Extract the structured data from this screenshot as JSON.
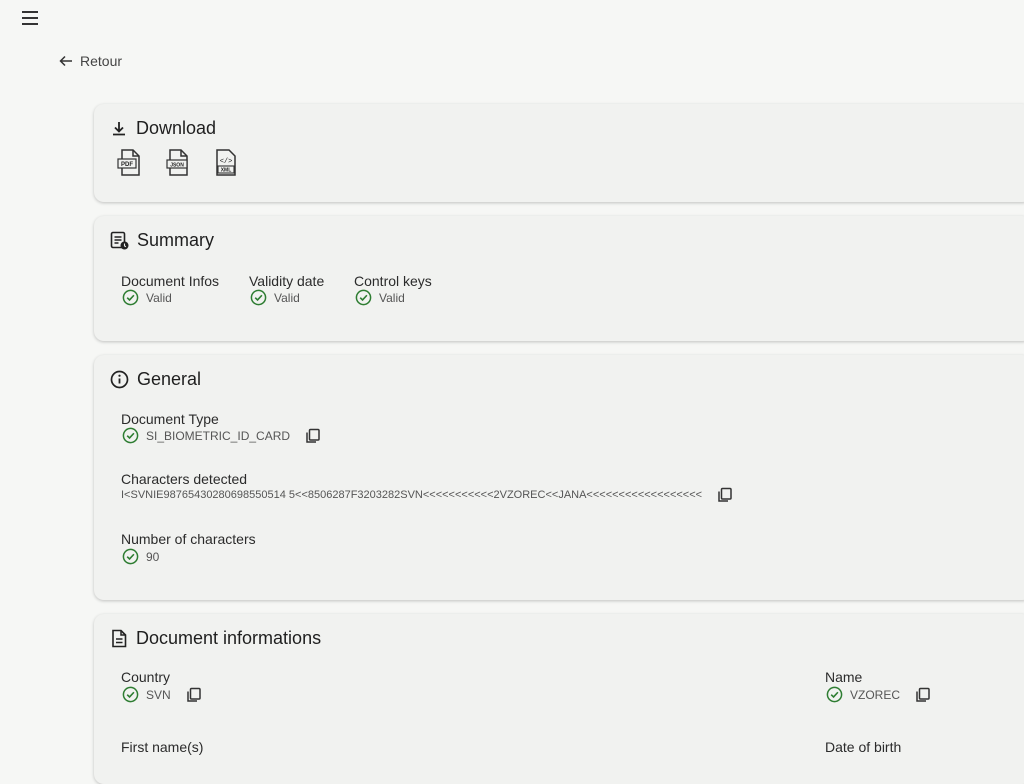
{
  "nav": {
    "back_label": "Retour"
  },
  "download": {
    "title": "Download",
    "files": [
      {
        "label": "PDF"
      },
      {
        "label": "JSON"
      },
      {
        "label": "XML"
      }
    ]
  },
  "summary": {
    "title": "Summary",
    "items": [
      {
        "label": "Document Infos",
        "value": "Valid"
      },
      {
        "label": "Validity date",
        "value": "Valid"
      },
      {
        "label": "Control keys",
        "value": "Valid"
      }
    ]
  },
  "general": {
    "title": "General",
    "document_type": {
      "label": "Document Type",
      "value": "SI_BIOMETRIC_ID_CARD"
    },
    "characters_detected": {
      "label": "Characters detected",
      "value": "I<SVNIE98765430280698550514 5<<8506287F3203282SVN<<<<<<<<<<<2VZOREC<<JANA<<<<<<<<<<<<<<<<<<"
    },
    "number_of_characters": {
      "label": "Number of characters",
      "value": "90"
    }
  },
  "document_informations": {
    "title": "Document informations",
    "country": {
      "label": "Country",
      "value": "SVN"
    },
    "name": {
      "label": "Name",
      "value": "VZOREC"
    },
    "first_names": {
      "label": "First name(s)"
    },
    "date_of_birth": {
      "label": "Date of birth"
    }
  },
  "colors": {
    "valid_green": "#2e7d32",
    "background": "#f6f7f5",
    "card": "#f1f2f0"
  }
}
